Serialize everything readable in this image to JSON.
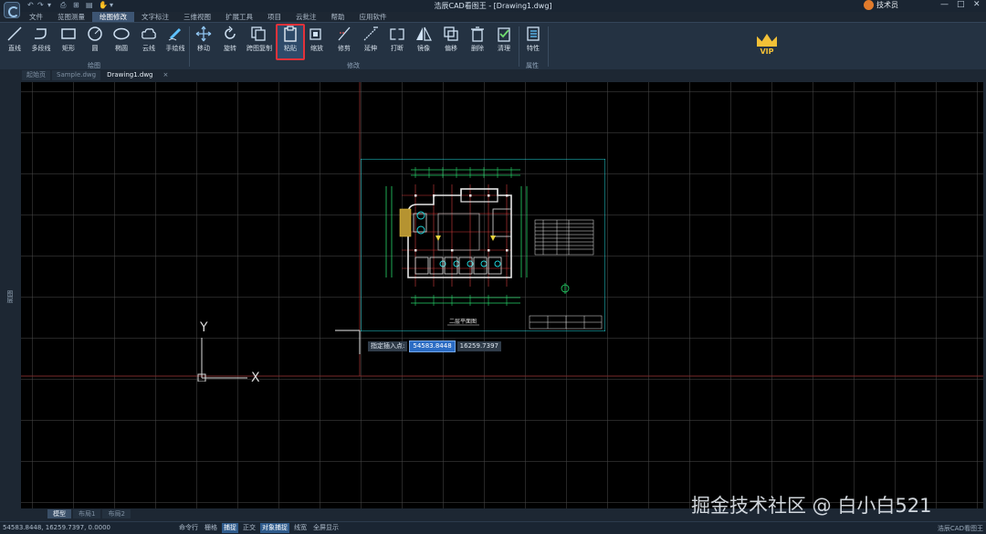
{
  "titlebar": {
    "title": "浩辰CAD看图王 - [Drawing1.dwg]",
    "user": "技术员",
    "controls": [
      "—",
      "□",
      "✕"
    ]
  },
  "quick_access": [
    "↶",
    "↷",
    "▾",
    "⎙",
    "⊞",
    "▤",
    "✋",
    "▾"
  ],
  "menu": {
    "tabs": [
      "文件",
      "览图测量",
      "绘图修改",
      "文字标注",
      "三维视图",
      "扩展工具",
      "项目",
      "云批注",
      "帮助",
      "应用软件"
    ],
    "active_index": 2
  },
  "ribbon": {
    "draw_tools": [
      "直线",
      "多段线",
      "矩形",
      "圆",
      "椭圆",
      "云线",
      "手绘线"
    ],
    "modify_tools": [
      "移动",
      "旋转",
      "跨图复制",
      "粘贴",
      "缩放",
      "修剪",
      "延伸",
      "打断",
      "镜像",
      "偏移",
      "删除",
      "清理"
    ],
    "prop_tools": [
      "特性"
    ],
    "group_draw": "绘图",
    "group_modify": "修改",
    "group_props": "属性",
    "vip_label": "VIP",
    "highlight_color": "#e5323a"
  },
  "doc_tabs": [
    "起始页",
    "Sample.dwg",
    "Drawing1.dwg"
  ],
  "doc_tab_active": 2,
  "side_strip_label": "图层",
  "drawing": {
    "title": "二层平面图"
  },
  "prompt": {
    "label": "指定插入点:",
    "x_value": "54583.8448",
    "y_value": "16259.7397"
  },
  "ucs": {
    "x_label": "X",
    "y_label": "Y"
  },
  "layout_tabs": [
    "模型",
    "布局1",
    "布局2"
  ],
  "status": {
    "coords": "54583.8448, 16259.7397, 0.0000",
    "items": [
      "命令行",
      "栅格",
      "捕捉",
      "正交",
      "对象捕捉",
      "线宽",
      "全屏显示"
    ],
    "on_items": [
      "捕捉",
      "对象捕捉"
    ],
    "brand": "浩辰CAD看图王"
  },
  "watermark": "掘金技术社区 @ 白小白521"
}
